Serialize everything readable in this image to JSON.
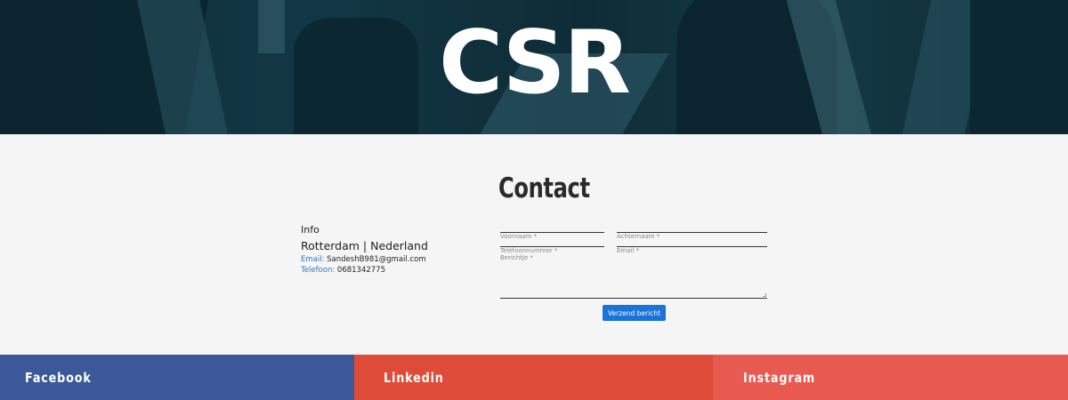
{
  "hero": {
    "title": "CSR"
  },
  "contact": {
    "heading": "Contact",
    "info": {
      "title": "Info",
      "city": "Rotterdam | Nederland",
      "email_label": "Email:",
      "email_value": "SandeshB981@gmail.com",
      "phone_label": "Telefoon:",
      "phone_value": "0681342775"
    },
    "form": {
      "voornaam_placeholder": "Voornaam *",
      "achternaam_placeholder": "Achternaam *",
      "telefoon_placeholder": "Telefoonnummer *",
      "email_placeholder": "Email *",
      "bericht_placeholder": "Berichtje *",
      "submit_label": "Verzend bericht"
    }
  },
  "footer": {
    "facebook": "Facebook",
    "linkedin": "Linkedin",
    "instagram": "Instagram"
  },
  "colors": {
    "facebook": "#3b5998",
    "linkedin": "#de4b39",
    "instagram": "#e85a50",
    "button": "#1a73d9",
    "link_label": "#2a7ac0"
  }
}
